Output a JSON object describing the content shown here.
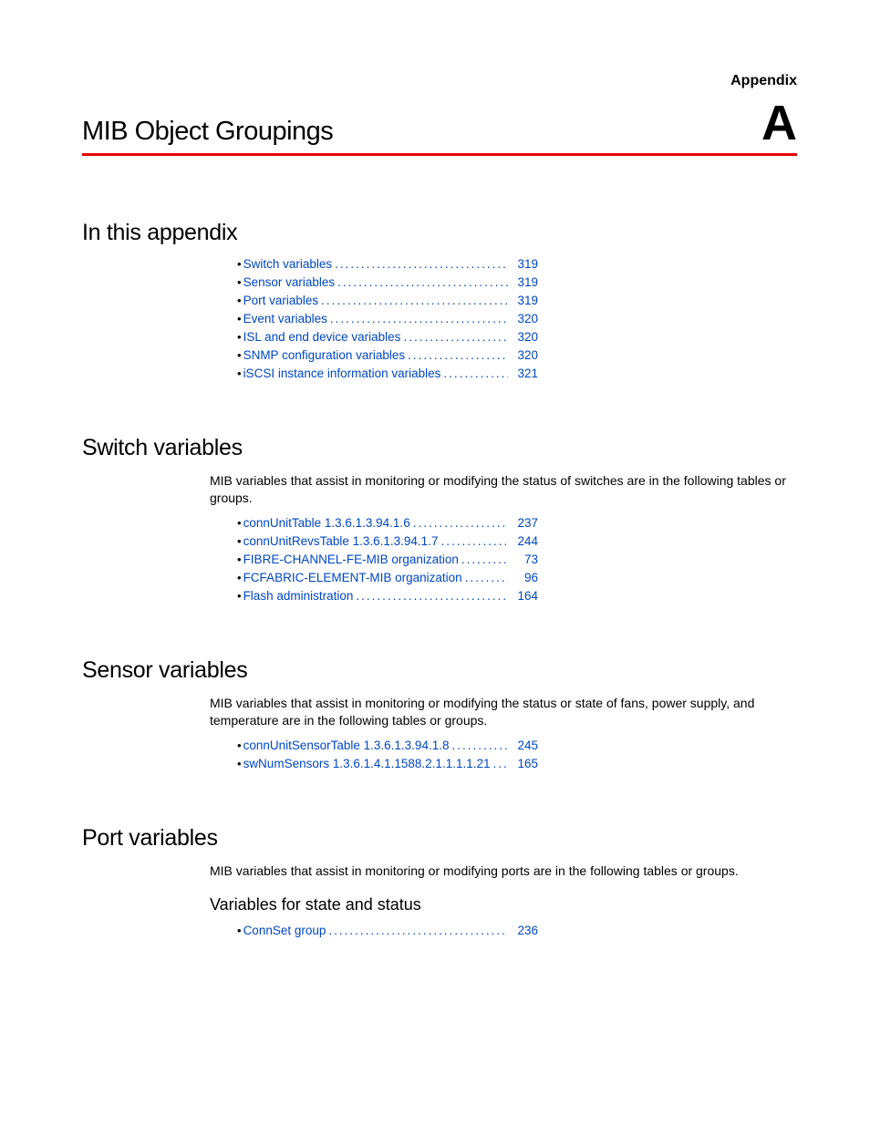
{
  "header": {
    "appendix_label": "Appendix",
    "appendix_letter": "A",
    "title": "MIB Object Groupings"
  },
  "sections": {
    "in_this_appendix": {
      "heading": "In this appendix",
      "items": [
        {
          "label": "Switch variables",
          "page": "319"
        },
        {
          "label": "Sensor variables",
          "page": "319"
        },
        {
          "label": "Port variables",
          "page": "319"
        },
        {
          "label": "Event variables",
          "page": "320"
        },
        {
          "label": "ISL and end device variables",
          "page": "320"
        },
        {
          "label": "SNMP configuration variables",
          "page": "320"
        },
        {
          "label": "iSCSI instance information variables",
          "page": "321"
        }
      ]
    },
    "switch_variables": {
      "heading": "Switch variables",
      "body": "MIB variables that assist in monitoring or modifying the status of switches are in the following tables or groups.",
      "items": [
        {
          "label": "connUnitTable 1.3.6.1.3.94.1.6",
          "page": "237"
        },
        {
          "label": "connUnitRevsTable 1.3.6.1.3.94.1.7",
          "page": "244"
        },
        {
          "label": "FIBRE-CHANNEL-FE-MIB organization",
          "page": "73"
        },
        {
          "label": "FCFABRIC-ELEMENT-MIB organization",
          "page": "96"
        },
        {
          "label": "Flash administration",
          "page": "164"
        }
      ]
    },
    "sensor_variables": {
      "heading": "Sensor variables",
      "body": "MIB variables that assist in monitoring or modifying the status or state of fans, power supply, and temperature are in the following tables or groups.",
      "items": [
        {
          "label": "connUnitSensorTable 1.3.6.1.3.94.1.8",
          "page": "245"
        },
        {
          "label": "swNumSensors 1.3.6.1.4.1.1588.2.1.1.1.1.21",
          "page": "165"
        }
      ]
    },
    "port_variables": {
      "heading": "Port variables",
      "body": "MIB variables that assist in monitoring or modifying ports are in the following tables or groups.",
      "sub_heading": "Variables for state and status",
      "items": [
        {
          "label": "ConnSet group",
          "page": "236"
        }
      ]
    }
  }
}
